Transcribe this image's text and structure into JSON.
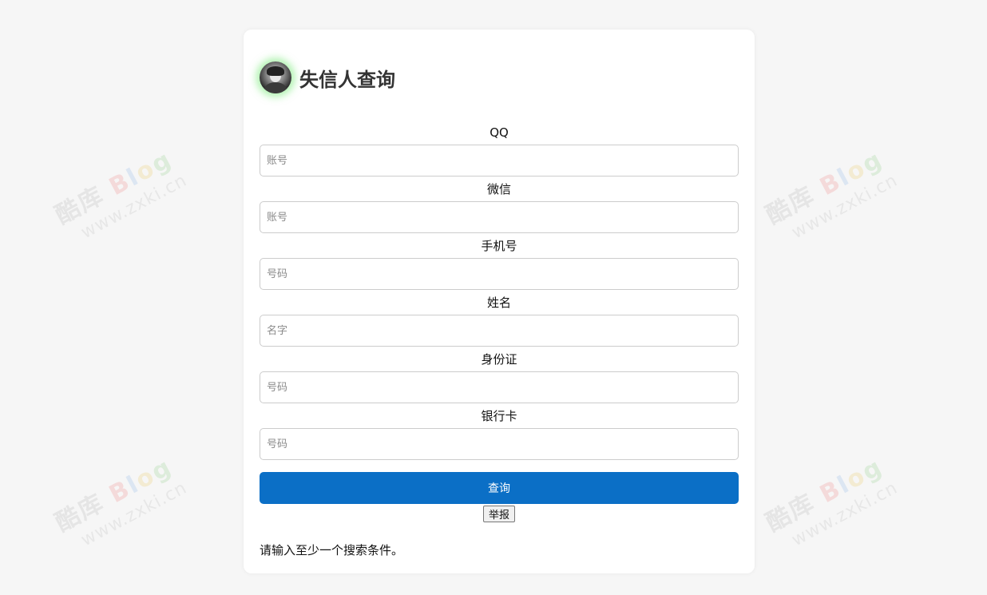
{
  "header": {
    "title": "失信人查询"
  },
  "fields": [
    {
      "label": "QQ",
      "placeholder": "账号",
      "value": ""
    },
    {
      "label": "微信",
      "placeholder": "账号",
      "value": ""
    },
    {
      "label": "手机号",
      "placeholder": "号码",
      "value": ""
    },
    {
      "label": "姓名",
      "placeholder": "名字",
      "value": ""
    },
    {
      "label": "身份证",
      "placeholder": "号码",
      "value": ""
    },
    {
      "label": "银行卡",
      "placeholder": "号码",
      "value": ""
    }
  ],
  "actions": {
    "submit_label": "查询",
    "report_label": "举报"
  },
  "status": {
    "message": "请输入至少一个搜索条件。"
  },
  "watermark": {
    "brand_prefix": "酷库",
    "brand_b": "B",
    "brand_l": "l",
    "brand_o": "o",
    "brand_g": "g",
    "url": "www.zxki.cn"
  },
  "colors": {
    "page_bg": "#f6f6f6",
    "card_bg": "#ffffff",
    "button_primary": "#0b6fc6",
    "avatar_glow": "#64e664"
  },
  "icons": {
    "avatar": "user-avatar-icon"
  }
}
